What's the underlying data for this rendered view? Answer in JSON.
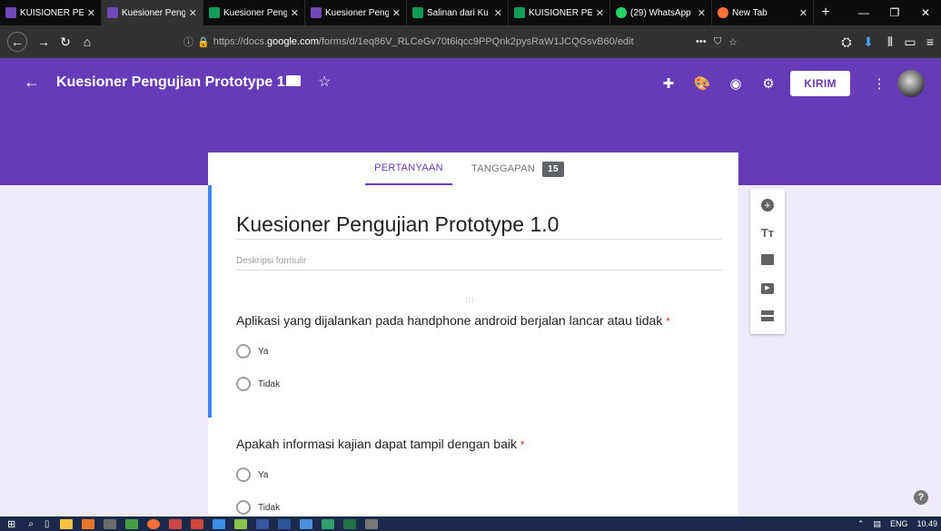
{
  "browser": {
    "tabs": [
      {
        "label": "KUISIONER PEN",
        "color": "#7248b9",
        "active": false
      },
      {
        "label": "Kuesioner Peng",
        "color": "#7248b9",
        "active": true
      },
      {
        "label": "Kuesioner Peng",
        "color": "#0f9d58",
        "active": false
      },
      {
        "label": "Kuesioner Peng",
        "color": "#7248b9",
        "active": false
      },
      {
        "label": "Salinan dari Ku",
        "color": "#0f9d58",
        "active": false
      },
      {
        "label": "KUISIONER PEN",
        "color": "#0f9d58",
        "active": false
      },
      {
        "label": "(29) WhatsApp",
        "color": "#25d366",
        "active": false
      },
      {
        "label": "New Tab",
        "color": "#ff7139",
        "active": false
      }
    ],
    "url_prefix": "https://docs.",
    "url_domain": "google.com",
    "url_rest": "/forms/d/1eq86V_RLCeGv70t6iqcc9PPQnk2pysRaW1JCQGsvB60/edit",
    "url_more": "•••"
  },
  "header": {
    "title": "Kuesioner Pengujian Prototype 1.0",
    "send_label": "KIRIM",
    "accent": "#673ab7"
  },
  "form_tabs": {
    "questions_label": "PERTANYAAN",
    "responses_label": "TANGGAPAN",
    "responses_count": "15"
  },
  "form": {
    "title": "Kuesioner Pengujian Prototype 1.0",
    "description_placeholder": "Deskripsi formulir",
    "questions": [
      {
        "text": "Aplikasi yang dijalankan pada handphone android berjalan lancar atau tidak",
        "required": "*",
        "options": [
          "Ya",
          "Tidak"
        ]
      },
      {
        "text": "Apakah informasi kajian dapat tampil dengan baik",
        "required": "*",
        "options": [
          "Ya",
          "Tidak"
        ]
      }
    ]
  },
  "toolbar_icons": [
    "add-question-icon",
    "add-title-icon",
    "add-image-icon",
    "add-video-icon",
    "add-section-icon"
  ],
  "help_label": "?",
  "taskbar": {
    "language": "ENG",
    "time": "10.49"
  }
}
